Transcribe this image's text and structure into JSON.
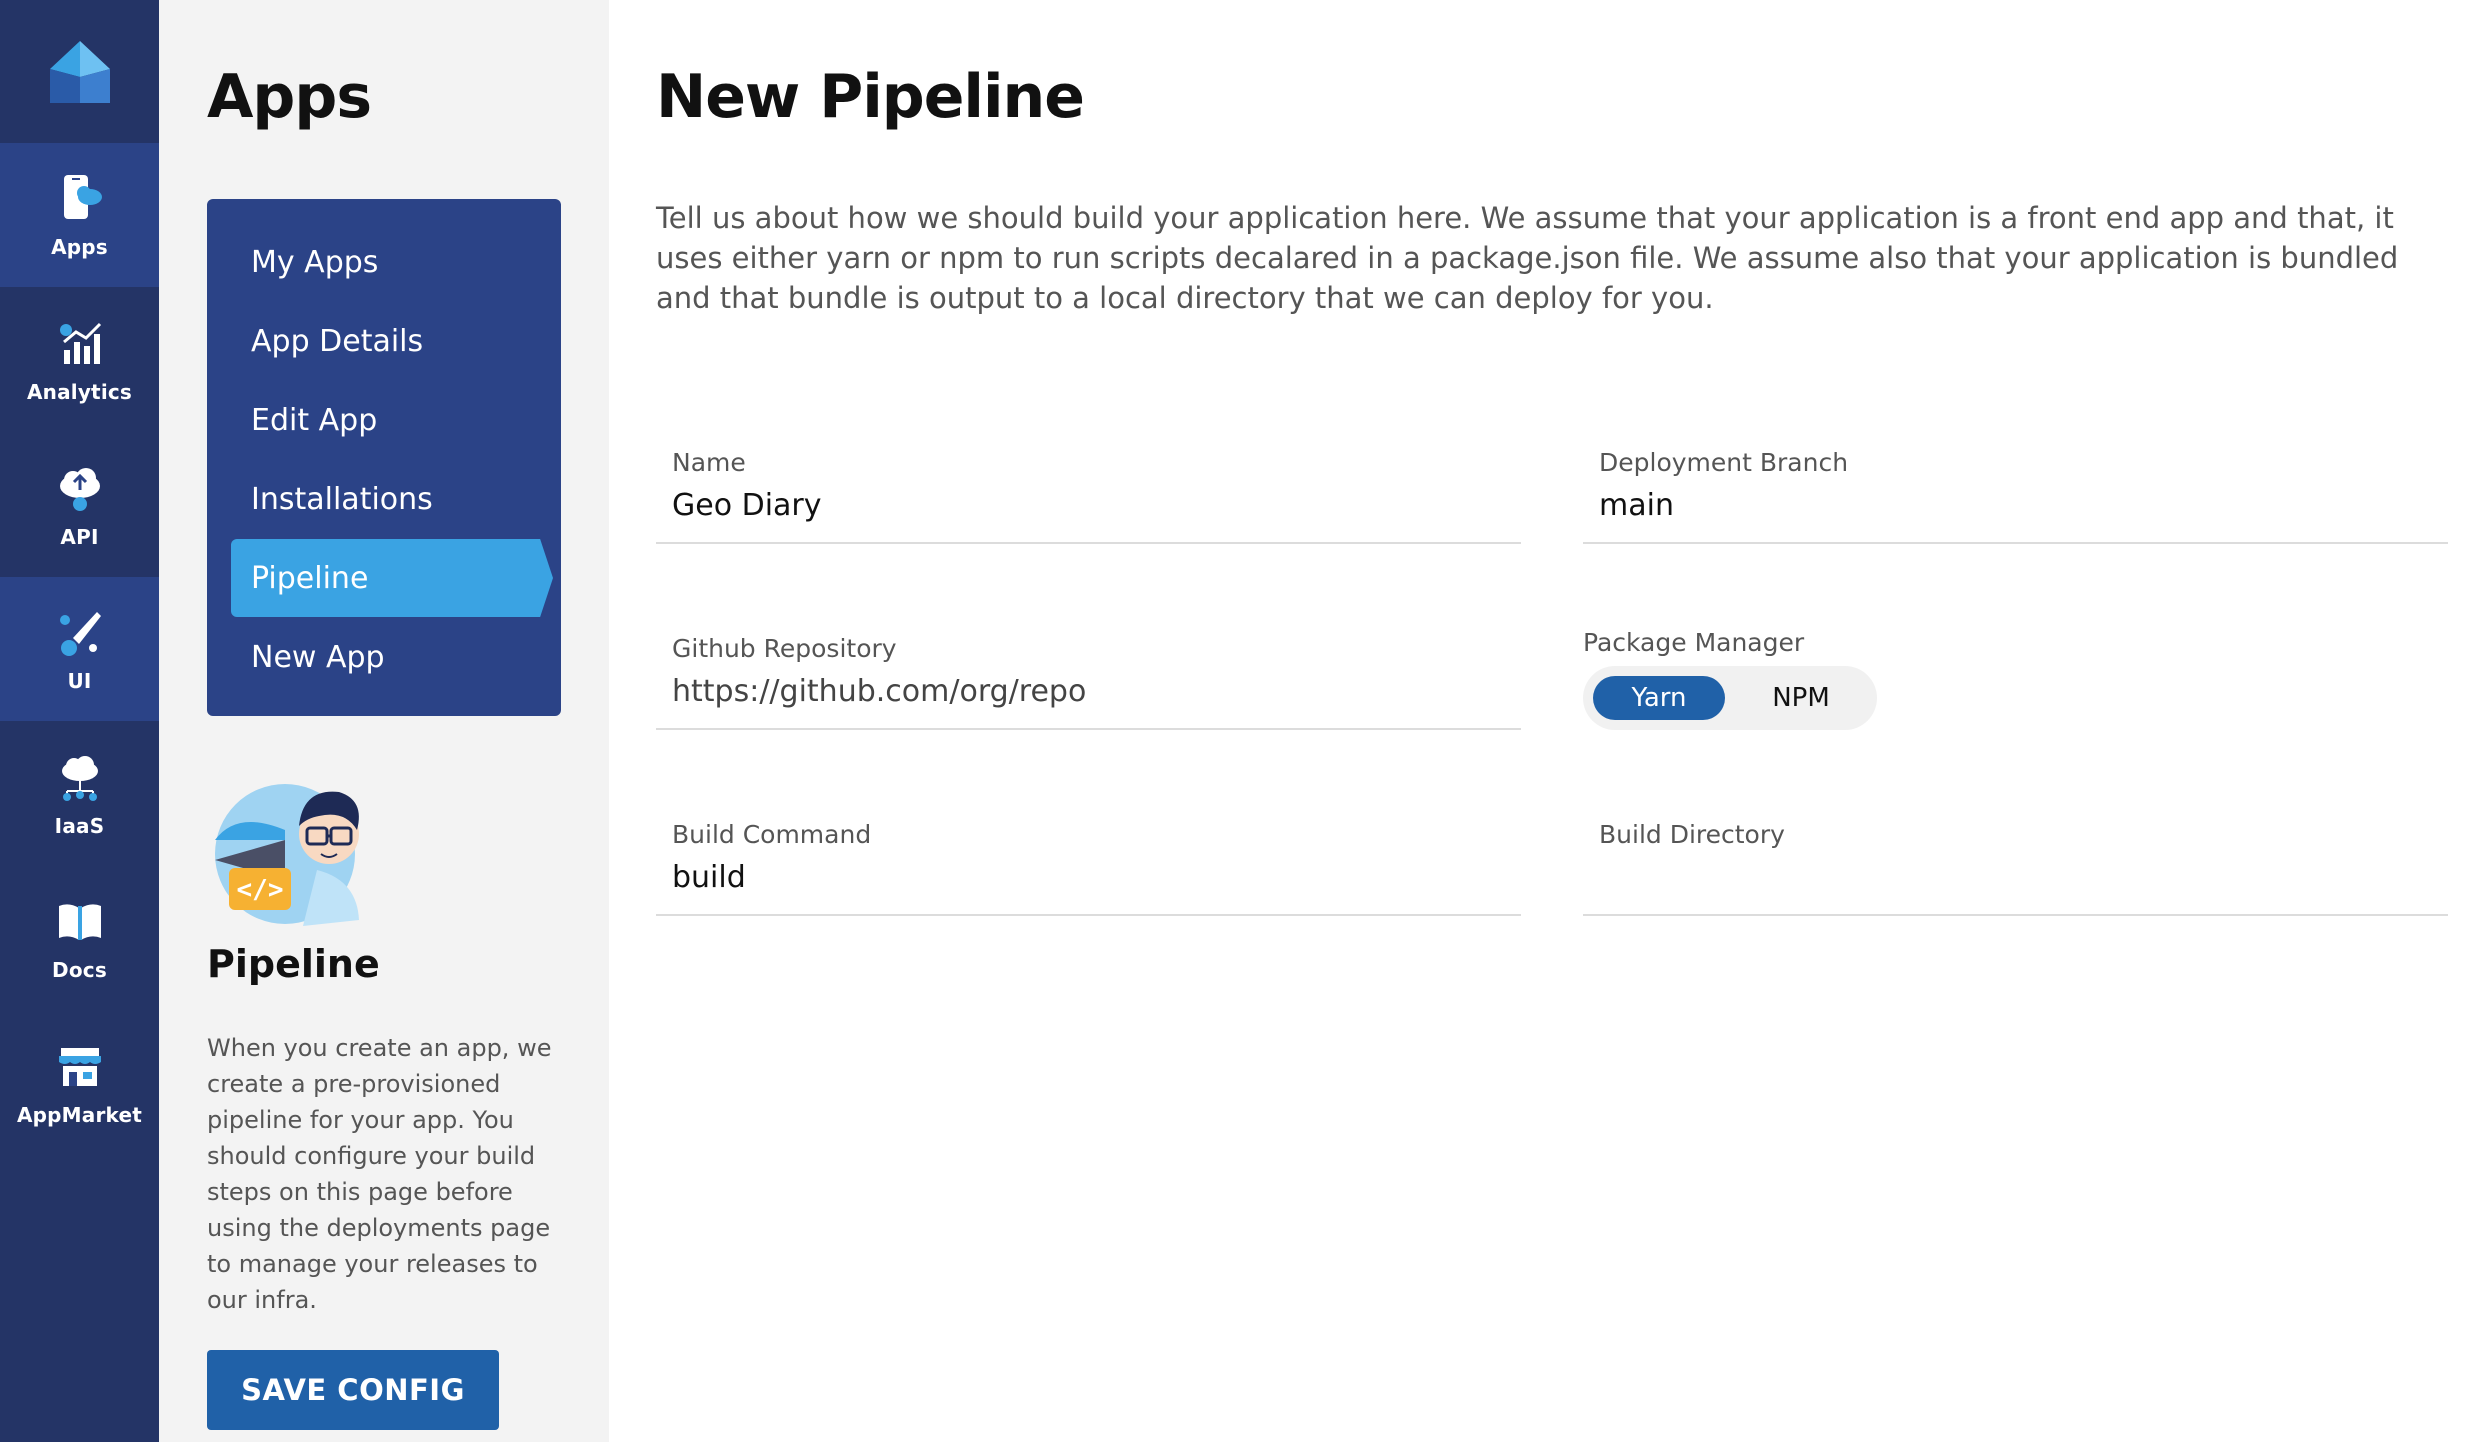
{
  "rail": {
    "items": [
      {
        "label": "Apps",
        "icon": "mobile-cloud-icon",
        "active": true
      },
      {
        "label": "Analytics",
        "icon": "analytics-chart-icon",
        "active": false
      },
      {
        "label": "API",
        "icon": "cloud-upload-icon",
        "active": false
      },
      {
        "label": "UI",
        "icon": "paint-brush-icon",
        "active": true
      },
      {
        "label": "IaaS",
        "icon": "cloud-network-icon",
        "active": false
      },
      {
        "label": "Docs",
        "icon": "book-icon",
        "active": false
      },
      {
        "label": "AppMarket",
        "icon": "storefront-icon",
        "active": false
      }
    ]
  },
  "subnav": {
    "title": "Apps",
    "menu": [
      {
        "label": "My Apps"
      },
      {
        "label": "App Details"
      },
      {
        "label": "Edit App"
      },
      {
        "label": "Installations"
      },
      {
        "label": "Pipeline",
        "active": true
      },
      {
        "label": "New App"
      }
    ],
    "section_heading": "Pipeline",
    "section_description": "When you create an app, we create a pre-provisioned pipeline for your app. You should configure your build steps on this page before using the deployments page to manage your releases to our infra.",
    "save_button": "SAVE CONFIG"
  },
  "main": {
    "title": "New Pipeline",
    "intro": "Tell us about how we should build your application here. We assume that your application is a front end app and that, it uses either yarn or npm to run scripts decalared in a package.json file. We assume also that your application is bundled and that bundle is output to a local directory that we can deploy for you.",
    "fields": {
      "name": {
        "label": "Name",
        "value": "Geo Diary"
      },
      "branch": {
        "label": "Deployment Branch",
        "value": "main"
      },
      "repo": {
        "label": "Github Repository",
        "value": "",
        "placeholder": "https://github.com/org/repo"
      },
      "build_command": {
        "label": "Build Command",
        "value": "build"
      },
      "build_directory": {
        "label": "Build Directory",
        "value": ""
      }
    },
    "package_manager": {
      "label": "Package Manager",
      "options": [
        "Yarn",
        "NPM"
      ],
      "selected": "Yarn"
    }
  },
  "colors": {
    "rail_bg": "#243466",
    "rail_active": "#2b4387",
    "menu_bg": "#2b4387",
    "menu_active": "#3aa3e3",
    "primary_button": "#2061a8",
    "sidebar_bg": "#f3f3f3"
  }
}
